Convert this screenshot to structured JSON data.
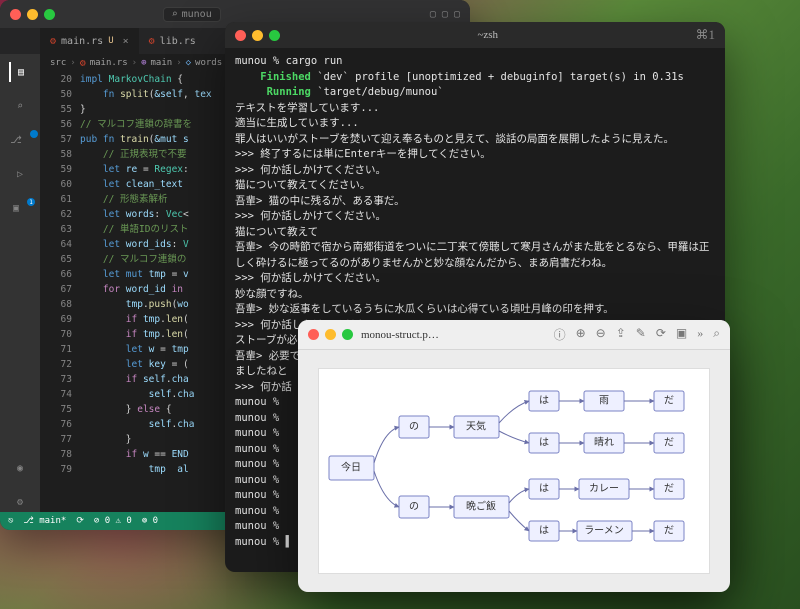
{
  "vscode": {
    "search_placeholder": "munou",
    "tabs": [
      {
        "icon": "rust",
        "name": "main.rs",
        "modified": "U",
        "active": true
      },
      {
        "icon": "rust",
        "name": "lib.rs",
        "modified": "",
        "active": false
      }
    ],
    "breadcrumb": [
      "src",
      "main.rs",
      "main",
      "words"
    ],
    "line_start": 20,
    "extra_lines": [
      50,
      55,
      56,
      57,
      58,
      59,
      60,
      61,
      62,
      63,
      64,
      65,
      66,
      67,
      68,
      69,
      70,
      71,
      72,
      73,
      74,
      75,
      76,
      77,
      78,
      79
    ],
    "code_lines": [
      {
        "i": 0,
        "html": "<span class='kw'>impl</span> <span class='ty'>MarkovChain</span> <span class='pu'>{</span>"
      },
      {
        "i": 1,
        "html": "    <span class='kw'>fn</span> <span class='fn'>split</span>(<span class='va'>&amp;self</span>, <span class='va'>tex</span>"
      },
      {
        "i": 2,
        "html": "<span class='pu'>}</span>"
      },
      {
        "i": 3,
        "html": "<span class='cm'>// マルコフ連鎖の辞書を</span>"
      },
      {
        "i": 4,
        "html": "<span class='kw'>pub fn</span> <span class='fn'>train</span>(<span class='va'>&amp;mut</span> <span class='va'>s</span>"
      },
      {
        "i": 5,
        "html": "    <span class='cm'>// 正規表現で不要</span>"
      },
      {
        "i": 6,
        "html": "    <span class='kw'>let</span> <span class='va'>re</span> = <span class='ty'>Regex</span>:"
      },
      {
        "i": 7,
        "html": "    <span class='kw'>let</span> <span class='va'>clean_text</span>"
      },
      {
        "i": 8,
        "html": "    <span class='cm'>// 形態素解析</span>"
      },
      {
        "i": 9,
        "html": "    <span class='kw'>let</span> <span class='va'>words</span>: <span class='ty'>Vec</span>&lt;"
      },
      {
        "i": 10,
        "html": "    <span class='cm'>// 単語IDのリスト</span>"
      },
      {
        "i": 11,
        "html": "    <span class='kw'>let</span> <span class='va'>word_ids</span>: <span class='ty'>V</span>"
      },
      {
        "i": 12,
        "html": "    <span class='cm'>// マルコフ連鎖の</span>"
      },
      {
        "i": 13,
        "html": "    <span class='kw'>let</span> <span class='kw'>mut</span> <span class='va'>tmp</span> = <span class='va'>v</span>"
      },
      {
        "i": 14,
        "html": "    <span class='se'>for</span> <span class='va'>word_id</span> <span class='se'>in</span> "
      },
      {
        "i": 15,
        "html": "        <span class='va'>tmp</span>.<span class='fn'>push</span>(<span class='va'>wo</span>"
      },
      {
        "i": 16,
        "html": "        <span class='se'>if</span> <span class='va'>tmp</span>.<span class='fn'>len</span>("
      },
      {
        "i": 17,
        "html": "        <span class='se'>if</span> <span class='va'>tmp</span>.<span class='fn'>len</span>("
      },
      {
        "i": 18,
        "html": "        <span class='kw'>let</span> <span class='va'>w</span> = <span class='va'>tmp</span>"
      },
      {
        "i": 19,
        "html": "        <span class='kw'>let</span> <span class='va'>key</span> = ("
      },
      {
        "i": 20,
        "html": "        <span class='se'>if</span> <span class='va'>self</span>.<span class='va'>cha</span>"
      },
      {
        "i": 21,
        "html": "            <span class='va'>self</span>.<span class='va'>cha</span>"
      },
      {
        "i": 22,
        "html": "        <span class='pu'>}</span> <span class='se'>else</span> <span class='pu'>{</span>"
      },
      {
        "i": 23,
        "html": "            <span class='va'>self</span>.<span class='va'>cha</span>"
      },
      {
        "i": 24,
        "html": "        <span class='pu'>}</span>"
      },
      {
        "i": 25,
        "html": "        <span class='se'>if</span> <span class='va'>w</span> == <span class='va'>END</span>"
      },
      {
        "i": 26,
        "html": "            <span class='va'>tmp</span>  <span class='va'>al</span>"
      }
    ],
    "status": {
      "branch": "main*",
      "errors": "0",
      "warnings": "0",
      "radio": "0"
    }
  },
  "terminal": {
    "title": "~zsh",
    "right_glyph": "⌘1",
    "lines": [
      "munou % cargo run",
      "    <g>Finished</g> `dev` profile [unoptimized + debuginfo] target(s) in 0.31s",
      "     <g>Running</g> `target/debug/munou`",
      "テキストを学習しています...",
      "適当に生成しています...",
      "罪人はいいがストーブを焚いて迎え奉るものと見えて、談話の局面を展開したように見えた。",
      ">>> 終了するには単にEnterキーを押してください。",
      ">>> 何か話しかけてください。",
      "猫について教えてください。",
      "吾輩> 猫の中に残るが、ある事だ。",
      ">>> 何か話しかけてください。",
      "猫について教えて",
      "吾輩> 今の時節で宿から南郷街道をついに二丁来て傍聴して寒月さんがまた匙をとるなら、甲羅は正しく砕けるに極ってるのがありませんかと妙な顔なんだから、まあ肩書だわね。",
      ">>> 何か話しかけてください。",
      "妙な顔ですね。",
      "吾輩> 妙な返事をしているうちに水瓜くらいは心得ている頃吐月峰の印を押す。",
      ">>> 何か話しかけてください。",
      "ストーブが必要ですか?",
      "吾輩> 必要で",
      "ましたねと",
      ">>> 何か話",
      "munou %",
      "munou %",
      "munou %",
      "munou %",
      "munou %",
      "munou %",
      "munou %",
      "munou %",
      "munou %",
      "munou % ▌"
    ]
  },
  "preview": {
    "filename": "monou-struct.p…",
    "nodes": {
      "kyou": "今日",
      "no1": "の",
      "no2": "の",
      "tenki": "天気",
      "bangohan": "晩ご飯",
      "wa1": "は",
      "wa2": "は",
      "wa3": "は",
      "wa4": "は",
      "ame": "雨",
      "hare": "晴れ",
      "curry": "カレー",
      "ramen": "ラーメン",
      "da1": "だ",
      "da2": "だ",
      "da3": "だ",
      "da4": "だ"
    }
  }
}
